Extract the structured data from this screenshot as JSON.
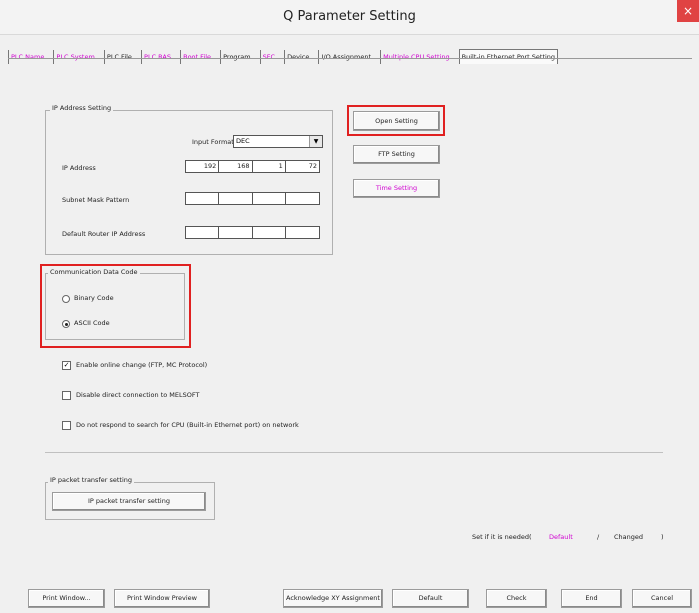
{
  "window": {
    "title": "Q Parameter Setting",
    "close_glyph": "×"
  },
  "tabs": [
    {
      "label": "PLC Name",
      "style": "magenta"
    },
    {
      "label": "PLC System",
      "style": "magenta"
    },
    {
      "label": "PLC File",
      "style": "black"
    },
    {
      "label": "PLC RAS",
      "style": "magenta"
    },
    {
      "label": "Boot File",
      "style": "magenta"
    },
    {
      "label": "Program",
      "style": "black"
    },
    {
      "label": "SFC",
      "style": "magenta"
    },
    {
      "label": "Device",
      "style": "black"
    },
    {
      "label": "I/O Assignment",
      "style": "black"
    },
    {
      "label": "Multiple CPU Setting",
      "style": "magenta"
    },
    {
      "label": "Built-in Ethernet Port Setting",
      "style": "active"
    }
  ],
  "ip_group": {
    "title": "IP Address Setting",
    "input_format_label": "Input Format",
    "input_format_value": "DEC",
    "ip_label": "IP Address",
    "ip": [
      "192",
      "168",
      "1",
      "72"
    ],
    "subnet_label": "Subnet Mask Pattern",
    "router_label": "Default Router IP Address"
  },
  "buttons": {
    "open_setting": "Open Setting",
    "ftp_setting": "FTP Setting",
    "time_setting": "Time Setting",
    "ip_packet": "IP packet transfer setting",
    "print_window": "Print Window...",
    "print_preview": "Print Window Preview",
    "acknowledge": "Acknowledge XY Assignment",
    "default": "Default",
    "check": "Check",
    "end": "End",
    "cancel": "Cancel"
  },
  "comm_group": {
    "title": "Communication Data Code",
    "binary": "Binary Code",
    "ascii": "ASCII Code"
  },
  "checks": {
    "enable_online": "Enable online change (FTP, MC Protocol)",
    "disable_direct": "Disable direct connection to MELSOFT",
    "no_respond": "Do not respond to search for CPU (Built-in Ethernet port) on network"
  },
  "ip_packet_group": {
    "title": "IP packet transfer setting"
  },
  "footer_hint": {
    "prefix": "Set if it is needed(",
    "default": "Default",
    "sep": "/",
    "changed": "Changed",
    "suffix": ")"
  },
  "colors": {
    "highlight": "#e02020",
    "magenta": "#d000d0"
  }
}
